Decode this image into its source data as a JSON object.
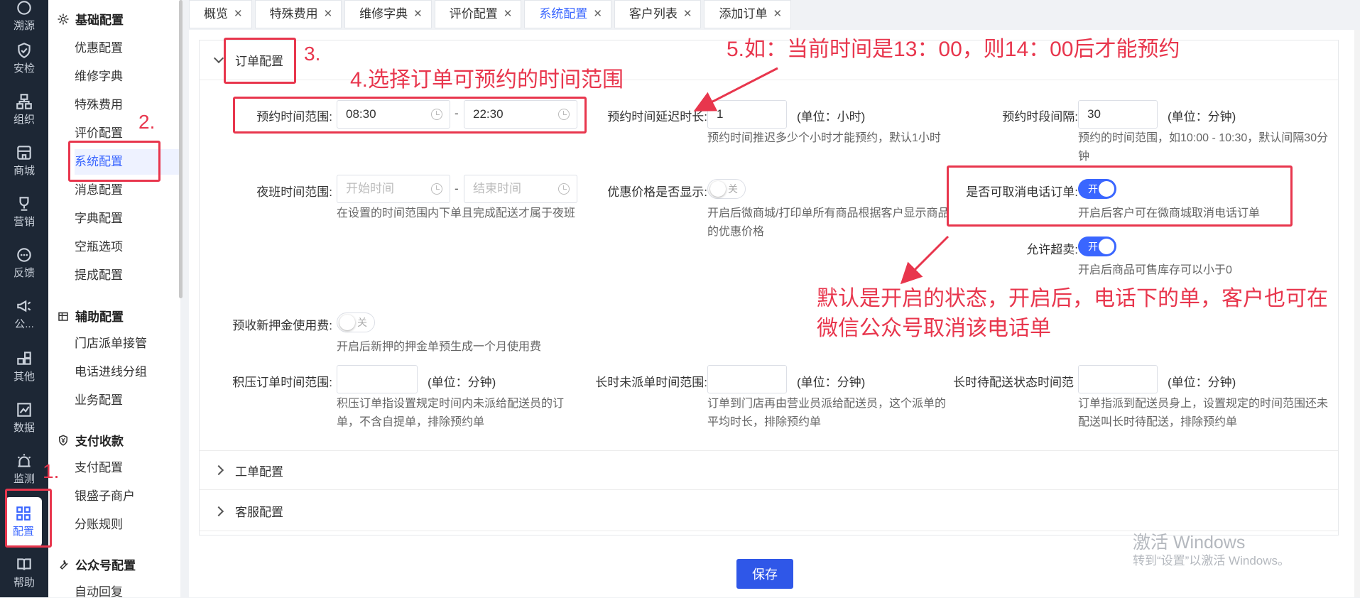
{
  "rail": [
    {
      "label": "溯源",
      "icon": "trace-icon"
    },
    {
      "label": "安检",
      "icon": "shield-check-icon"
    },
    {
      "label": "组织",
      "icon": "org-icon"
    },
    {
      "label": "商城",
      "icon": "store-icon"
    },
    {
      "label": "营销",
      "icon": "trophy-icon"
    },
    {
      "label": "反馈",
      "icon": "chat-icon"
    },
    {
      "label": "公...",
      "icon": "megaphone-icon"
    },
    {
      "label": "其他",
      "icon": "apps-icon"
    },
    {
      "label": "数据",
      "icon": "chart-icon"
    },
    {
      "label": "监测",
      "icon": "alarm-icon"
    },
    {
      "label": "配置",
      "icon": "grid-icon"
    },
    {
      "label": "帮助",
      "icon": "book-icon"
    }
  ],
  "menu": {
    "groups": [
      {
        "title": "基础配置",
        "icon": "gear-icon",
        "items": [
          "优惠配置",
          "维修字典",
          "特殊费用",
          "评价配置",
          "系统配置",
          "消息配置",
          "字典配置",
          "空瓶选项",
          "提成配置"
        ]
      },
      {
        "title": "辅助配置",
        "icon": "building-icon",
        "items": [
          "门店派单接管",
          "电话进线分组",
          "业务配置"
        ]
      },
      {
        "title": "支付收款",
        "icon": "yen-shield-icon",
        "items": [
          "支付配置",
          "银盛子商户",
          "分账规则"
        ]
      },
      {
        "title": "公众号配置",
        "icon": "wrench-icon",
        "items": [
          "自动回复"
        ]
      }
    ]
  },
  "tabs": [
    "概览",
    "特殊费用",
    "维修字典",
    "评价配置",
    "系统配置",
    "客户列表",
    "添加订单"
  ],
  "sections": [
    "订单配置",
    "工单配置",
    "客服配置"
  ],
  "form": {
    "booking_range_label": "预约时间范围:",
    "booking_start": "08:30",
    "booking_end": "22:30",
    "range_sep": "-",
    "delay_label": "预约时间延迟时长:",
    "delay_value": "1",
    "delay_unit": "(单位：小时)",
    "delay_help": "预约时间推迟多少个小时才能预约，默认1小时",
    "interval_label": "预约时段间隔:",
    "interval_value": "30",
    "interval_unit": "(单位：分钟)",
    "interval_help": "预约的时间范围，如10:00 - 10:30，默认间隔30分钟",
    "night_label": "夜班时间范围:",
    "night_start_ph": "开始时间",
    "night_end_ph": "结束时间",
    "night_help": "在设置的时间范围内下单且完成配送才属于夜班",
    "discount_label": "优惠价格是否显示:",
    "discount_switch": "关",
    "discount_help": "开启后微商城/打印单所有商品根据客户显示商品的优惠价格",
    "cancel_phone_label": "是否可取消电话订单:",
    "cancel_phone_switch": "开",
    "cancel_phone_help": "开启后客户可在微商城取消电话订单",
    "oversell_label": "允许超卖:",
    "oversell_switch": "开",
    "oversell_help": "开启后商品可售库存可以小于0",
    "deposit_label": "预收新押金使用费:",
    "deposit_switch": "关",
    "deposit_help": "开启后新押的押金单预生成一个月使用费",
    "backlog_label": "积压订单时间范围:",
    "backlog_unit": "(单位：分钟)",
    "backlog_help": "积压订单指设置规定时间内未派给配送员的订单，不含自提单，排除预约单",
    "undispatched_label": "长时未派单时间范围:",
    "undispatched_unit": "(单位：分钟)",
    "undispatched_help": "订单到门店再由营业员派给配送员，这个派单的平均时长，排除预约单",
    "waiting_label": "长时待配送状态时间范",
    "waiting_unit": "(单位：分钟)",
    "waiting_help": "订单指派到配送员身上，设置规定的时间范围还未配送叫长时待配送，排除预约单"
  },
  "annotations": {
    "n1": "1.",
    "n2": "2.",
    "n3": "3.",
    "n4": "4.选择订单可预约的时间范围",
    "n5": "5.如：当前时间是13：00，则14：00后才能预约",
    "note": "默认是开启的状态，开启后，电话下的单，客户也可在微信公众号取消该电话单"
  },
  "save_label": "保存",
  "watermark": {
    "line1": "激活 Windows",
    "line2": "转到“设置”以激活 Windows。"
  },
  "colors": {
    "accent": "#3a66ff",
    "annotation": "#e8364d",
    "rail": "#1d2735"
  }
}
